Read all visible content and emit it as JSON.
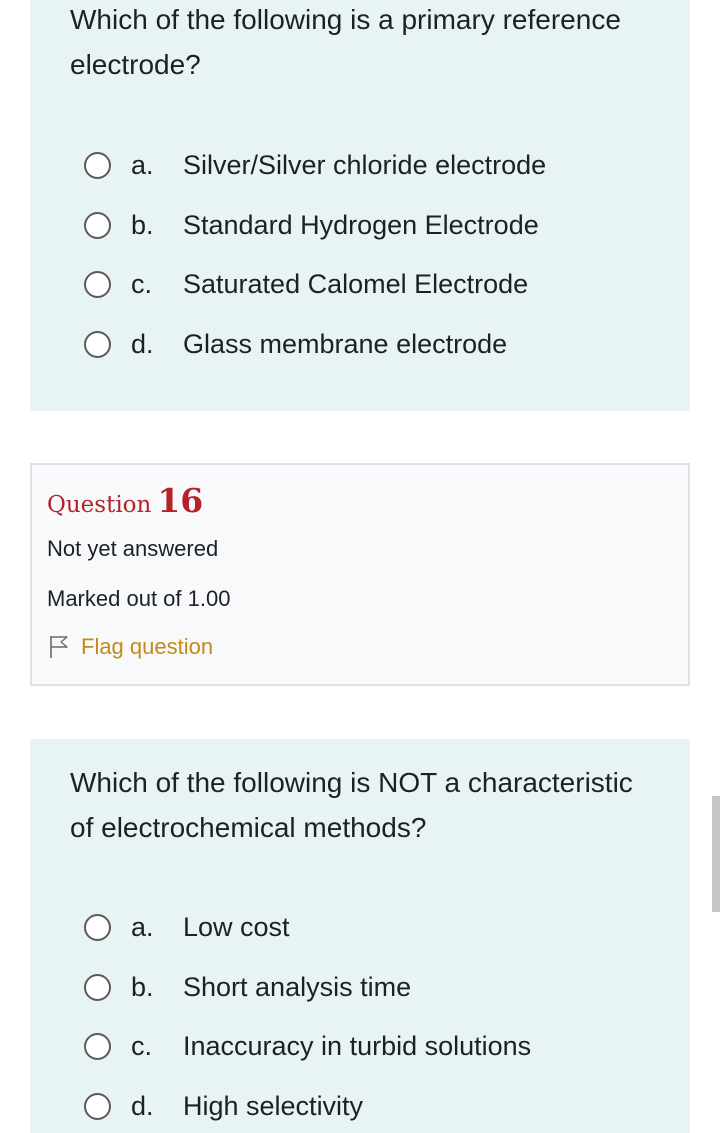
{
  "question15": {
    "prompt": "Which of the following is a primary reference electrode?",
    "answers": [
      {
        "letter": "a.",
        "text": "Silver/Silver chloride electrode"
      },
      {
        "letter": "b.",
        "text": "Standard Hydrogen Electrode"
      },
      {
        "letter": "c.",
        "text": "Saturated Calomel Electrode"
      },
      {
        "letter": "d.",
        "text": "Glass membrane electrode"
      }
    ]
  },
  "question16": {
    "label": "Question",
    "number": "16",
    "status": "Not yet answered",
    "marks": "Marked out of 1.00",
    "flag_label": "Flag question",
    "flag_icon": "flag-outline-icon",
    "prompt": "Which of the following is NOT a characteristic of electrochemical methods?",
    "answers": [
      {
        "letter": "a.",
        "text": "Low cost"
      },
      {
        "letter": "b.",
        "text": "Short analysis time"
      },
      {
        "letter": "c.",
        "text": "Inaccuracy in turbid solutions"
      },
      {
        "letter": "d.",
        "text": "High selectivity"
      }
    ]
  },
  "colors": {
    "question_bg": "#e7f3f5",
    "info_bg": "#f8f9fa",
    "question_number": "#b5232a",
    "flag": "#c28a1a"
  }
}
